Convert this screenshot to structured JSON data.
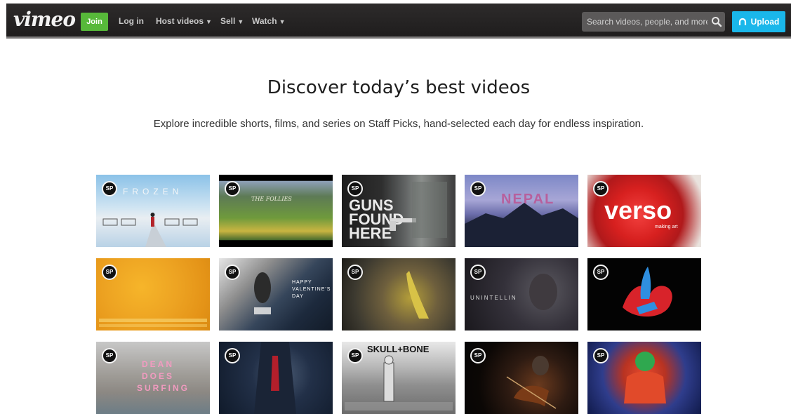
{
  "nav": {
    "logo": "vimeo",
    "join_label": "Join",
    "login_label": "Log in",
    "host_label": "Host videos",
    "sell_label": "Sell",
    "watch_label": "Watch",
    "search_placeholder": "Search videos, people, and more",
    "upload_label": "Upload"
  },
  "hero": {
    "title": "Discover today’s best videos",
    "subtitle": "Explore incredible shorts, films, and series on Staff Picks, hand-selected each day for endless inspiration."
  },
  "badge_label": "SP",
  "videos": [
    {
      "title": "FROZEN"
    },
    {
      "title": "THE FOLLIES"
    },
    {
      "title": "GUNS FOUND HERE"
    },
    {
      "title": "NEPAL"
    },
    {
      "title": "verso",
      "tagline": "making art"
    },
    {
      "title": ""
    },
    {
      "title": "HAPPY VALENTINE'S DAY"
    },
    {
      "title": ""
    },
    {
      "title": "UNINTELLIN"
    },
    {
      "title": ""
    },
    {
      "title": "DEAN DOES SURFING"
    },
    {
      "title": ""
    },
    {
      "title": "SKULL+BONE"
    },
    {
      "title": ""
    },
    {
      "title": ""
    }
  ],
  "colors": {
    "nav_bg": "#262424",
    "join_green": "#57b93a",
    "upload_blue": "#1ab7ea"
  }
}
